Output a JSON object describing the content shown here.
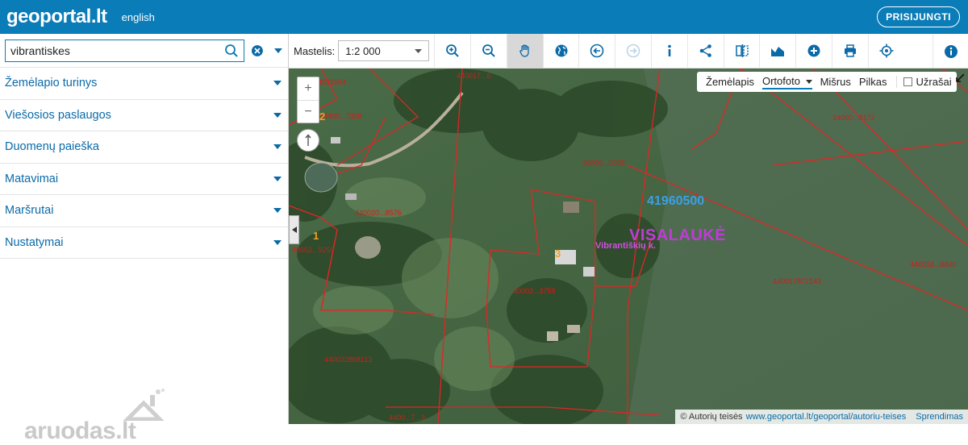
{
  "header": {
    "logo": "geoportal.lt",
    "language": "english",
    "login_label": "PRISIJUNGTI"
  },
  "search": {
    "value": "vibrantiskes"
  },
  "menu": [
    {
      "label": "Žemėlapio turinys"
    },
    {
      "label": "Viešosios paslaugos"
    },
    {
      "label": "Duomenų paieška"
    },
    {
      "label": "Matavimai"
    },
    {
      "label": "Maršrutai"
    },
    {
      "label": "Nustatymai"
    }
  ],
  "watermark": "aruodas.lt",
  "toolbar": {
    "scale_label": "Mastelis:",
    "scale_value": "1:2 000",
    "tools": [
      {
        "name": "zoom-in-icon",
        "active": false
      },
      {
        "name": "zoom-out-icon",
        "active": false
      },
      {
        "name": "pan-hand-icon",
        "active": true
      },
      {
        "name": "globe-icon",
        "active": false
      },
      {
        "name": "back-icon",
        "active": false
      },
      {
        "name": "forward-icon",
        "active": false
      },
      {
        "name": "info-icon",
        "active": false
      },
      {
        "name": "share-icon",
        "active": false
      },
      {
        "name": "compare-icon",
        "active": false
      },
      {
        "name": "profile-icon",
        "active": false
      },
      {
        "name": "add-icon",
        "active": false
      },
      {
        "name": "print-icon",
        "active": false
      },
      {
        "name": "locate-icon",
        "active": false
      }
    ]
  },
  "map": {
    "zoom_in": "+",
    "zoom_out": "−",
    "basemaps": {
      "items": [
        "Žemėlapis",
        "Ortofoto",
        "Mišrus",
        "Pilkas"
      ],
      "active": "Ortofoto",
      "labels_toggle": "Užrašai"
    },
    "labels": {
      "parcels": [
        "4091694",
        "24400...7328",
        "40000...0098",
        "440020...8576",
        "40002...9259",
        "40002...3759",
        "440022868113",
        "34000...8172",
        "440017872143",
        "440018...8840",
        "440017...6",
        "4400...7...3"
      ],
      "block_number": "41960500",
      "place_name": "VISALAUKĖ",
      "village": "Vibrantiškių k.",
      "plot_1": "1",
      "plot_2": "2",
      "plot_3": "3"
    },
    "attribution": {
      "text": "© Autorių teisės",
      "link": "www.geoportal.lt/geoportal/autoriu-teises",
      "link2": "Sprendimas"
    }
  }
}
